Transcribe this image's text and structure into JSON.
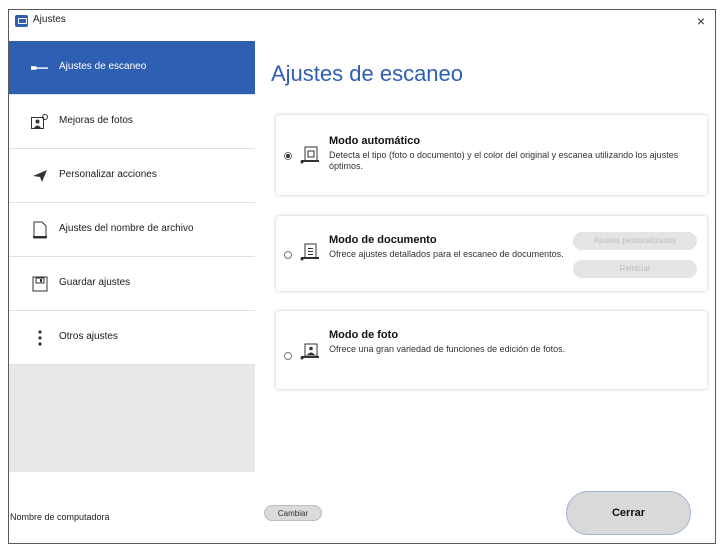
{
  "window": {
    "title": "Ajustes",
    "close_glyph": "×"
  },
  "sidebar": {
    "items": [
      {
        "label": "Ajustes de escaneo",
        "icon": "scan-settings-icon",
        "active": true
      },
      {
        "label": "Mejoras de fotos",
        "icon": "photo-enhance-icon",
        "active": false
      },
      {
        "label": "Personalizar acciones",
        "icon": "paper-plane-icon",
        "active": false
      },
      {
        "label": "Ajustes del nombre de archivo",
        "icon": "document-icon",
        "active": false
      },
      {
        "label": "Guardar ajustes",
        "icon": "save-icon",
        "active": false
      },
      {
        "label": "Otros ajustes",
        "icon": "more-vertical-icon",
        "active": false
      }
    ]
  },
  "main": {
    "title": "Ajustes de escaneo",
    "modes": [
      {
        "title": "Modo automático",
        "desc": "Detecta el tipo (foto o documento) y el color del original y escanea utilizando los ajustes óptimos.",
        "selected": true,
        "icon": "auto-mode-icon"
      },
      {
        "title": "Modo de documento",
        "desc": "Ofrece ajustes detallados para el escaneo de documentos.",
        "selected": false,
        "icon": "document-mode-icon",
        "buttons": {
          "custom": "Ajustes personalizados",
          "reset": "Reiniciar"
        }
      },
      {
        "title": "Modo de foto",
        "desc": "Ofrece una gran variedad de funciones de edición de fotos.",
        "selected": false,
        "icon": "photo-mode-icon"
      }
    ]
  },
  "footer": {
    "computer_name_label": "Nombre de computadora",
    "change_button": "Cambiar",
    "close_button": "Cerrar"
  },
  "colors": {
    "accent": "#2f5fb3",
    "sidebar_bg": "#e8e8e8"
  }
}
